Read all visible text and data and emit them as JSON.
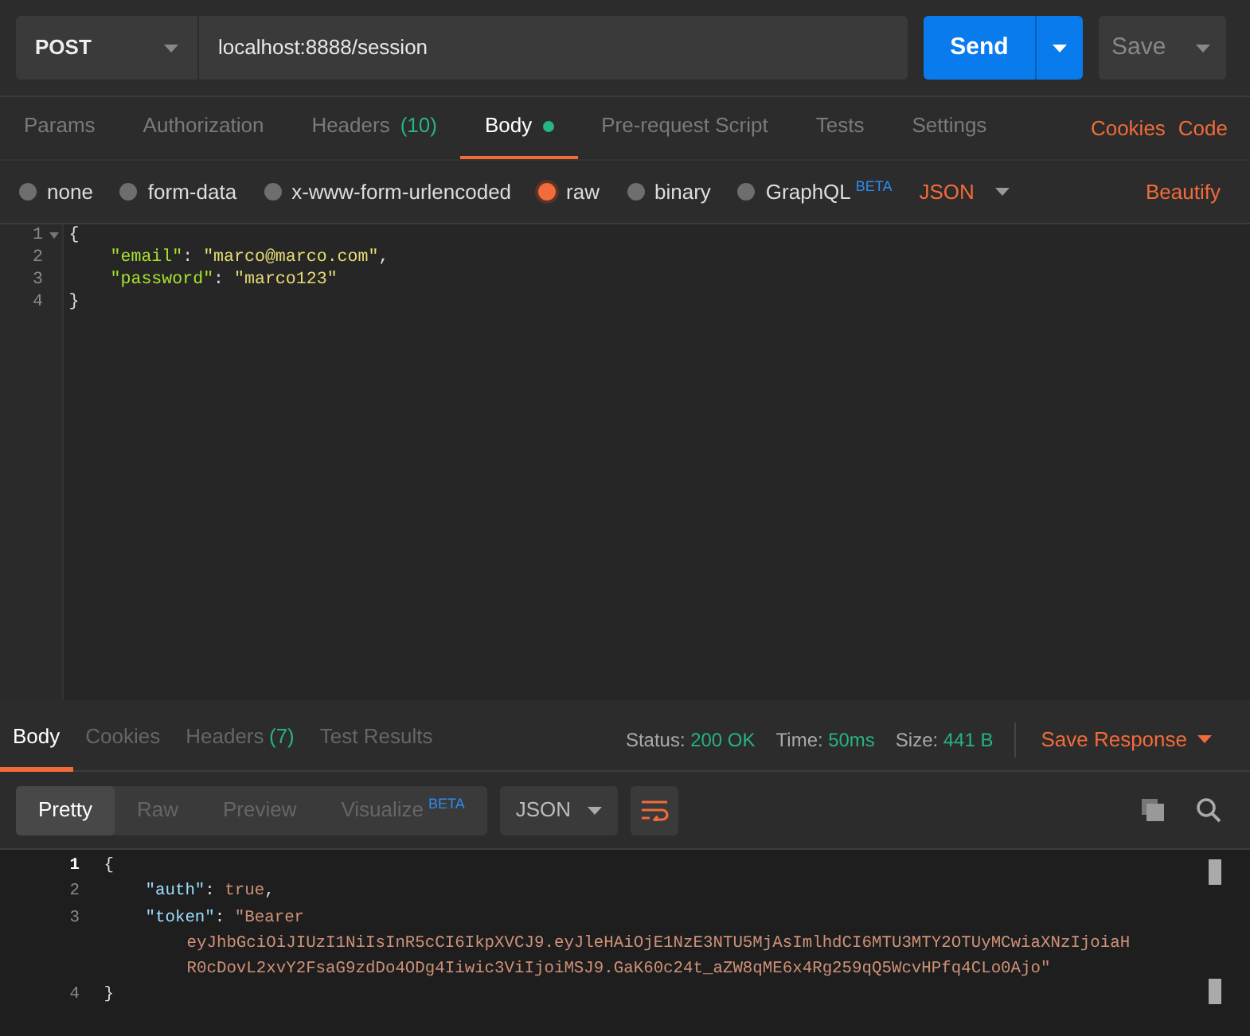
{
  "request": {
    "method": "POST",
    "url": "localhost:8888/session",
    "send": "Send",
    "save": "Save"
  },
  "request_tabs": [
    {
      "label": "Params",
      "selected": false
    },
    {
      "label": "Authorization",
      "selected": false
    },
    {
      "label": "Headers",
      "count": "(10)",
      "selected": false
    },
    {
      "label": "Body",
      "dot": true,
      "selected": true
    },
    {
      "label": "Pre-request Script",
      "selected": false
    },
    {
      "label": "Tests",
      "selected": false
    },
    {
      "label": "Settings",
      "selected": false
    }
  ],
  "links": [
    "Cookies",
    "Code"
  ],
  "body_types": [
    {
      "label": "none",
      "selected": false
    },
    {
      "label": "form-data",
      "selected": false
    },
    {
      "label": "x-www-form-urlencoded",
      "selected": false
    },
    {
      "label": "raw",
      "selected": true
    },
    {
      "label": "binary",
      "selected": false
    },
    {
      "label": "GraphQL",
      "badge": "BETA",
      "selected": false
    }
  ],
  "body_format": "JSON",
  "beautify": "Beautify",
  "request_code": [
    {
      "number": "1",
      "foldable": true,
      "indented": false,
      "tokens": [
        {
          "kind": "punct",
          "text": "{"
        }
      ]
    },
    {
      "number": "2",
      "foldable": false,
      "indented": true,
      "tokens": [
        {
          "kind": "key",
          "text": "\"email\""
        },
        {
          "kind": "punct",
          "text": ": "
        },
        {
          "kind": "string",
          "text": "\"marco@marco.com\""
        },
        {
          "kind": "punct",
          "text": ","
        }
      ]
    },
    {
      "number": "3",
      "foldable": false,
      "indented": true,
      "tokens": [
        {
          "kind": "key",
          "text": "\"password\""
        },
        {
          "kind": "punct",
          "text": ": "
        },
        {
          "kind": "string",
          "text": "\"marco123\""
        }
      ]
    },
    {
      "number": "4",
      "foldable": false,
      "indented": false,
      "tokens": [
        {
          "kind": "punct",
          "text": "}"
        }
      ]
    }
  ],
  "response_tabs": [
    {
      "label": "Body",
      "selected": true
    },
    {
      "label": "Cookies",
      "selected": false
    },
    {
      "label": "Headers",
      "count": "(7)",
      "selected": false
    },
    {
      "label": "Test Results",
      "selected": false
    }
  ],
  "response_stats": [
    {
      "label": "Status:",
      "value": "200 OK"
    },
    {
      "label": "Time:",
      "value": "50ms"
    },
    {
      "label": "Size:",
      "value": "441 B"
    }
  ],
  "save_response": "Save Response",
  "view_modes": [
    {
      "label": "Pretty",
      "selected": true
    },
    {
      "label": "Raw",
      "selected": false
    },
    {
      "label": "Preview",
      "selected": false
    },
    {
      "label": "Visualize",
      "badge": "BETA",
      "selected": false
    }
  ],
  "response_format": "JSON",
  "response_code": [
    {
      "number": "1",
      "current": true,
      "indented": false,
      "tokens": [
        {
          "kind": "punct",
          "text": "{"
        }
      ]
    },
    {
      "number": "2",
      "current": false,
      "indented": true,
      "tokens": [
        {
          "kind": "key",
          "text": "\"auth\""
        },
        {
          "kind": "punct",
          "text": ": "
        },
        {
          "kind": "bool",
          "text": "true"
        },
        {
          "kind": "punct",
          "text": ","
        }
      ]
    },
    {
      "number": "3",
      "current": false,
      "indented": true,
      "tokens": [
        {
          "kind": "key",
          "text": "\"token\""
        },
        {
          "kind": "punct",
          "text": ": "
        },
        {
          "kind": "string",
          "text": "\"Bearer"
        }
      ],
      "wrapped": [
        "eyJhbGciOiJIUzI1NiIsInR5cCI6IkpXVCJ9.eyJleHAiOjE1NzE3NTU5MjAsImlhdCI6MTU3MTY2OTUyMCwiaXNzIjoiaH",
        "R0cDovL2xvY2FsaG9zdDo4ODg4Iiwic3ViIjoiMSJ9.GaK60c24t_aZW8qME6x4Rg259qQ5WcvHPfq4CLo0Ajo\""
      ]
    },
    {
      "number": "4",
      "current": false,
      "indented": false,
      "tokens": [
        {
          "kind": "punct",
          "text": "}"
        }
      ]
    }
  ]
}
